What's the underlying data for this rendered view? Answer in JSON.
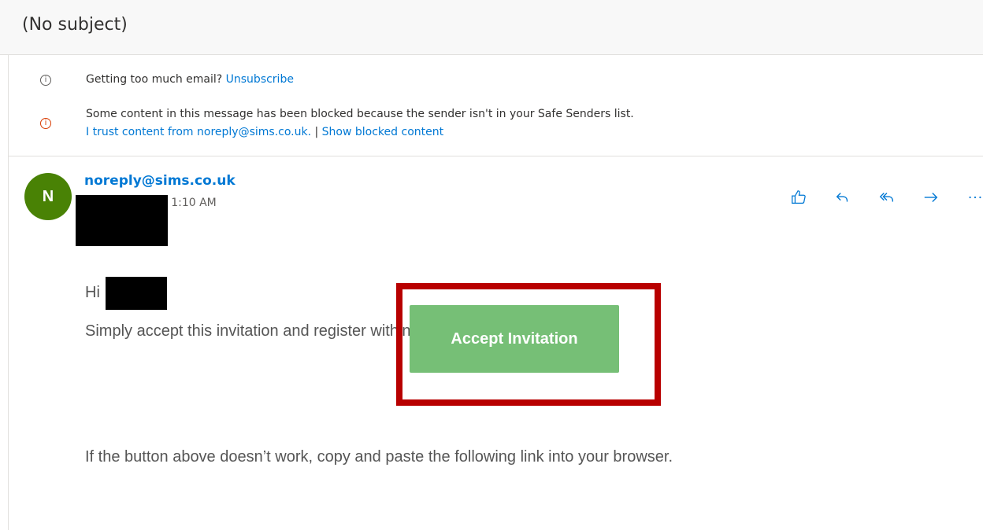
{
  "message": {
    "subject": "(No subject)",
    "sender": "noreply@sims.co.uk",
    "avatar_initial": "N",
    "date": "Mon 3/30/2020 1:10 AM"
  },
  "notices": {
    "unsubscribe_prefix": "Getting too much email?",
    "unsubscribe_link": "Unsubscribe",
    "blocked_message": "Some content in this message has been blocked because the sender isn't in your Safe Senders list.",
    "trust_link": "I trust content from noreply@sims.co.uk.",
    "separator": "|",
    "show_blocked_link": "Show blocked content"
  },
  "actions": [
    {
      "name": "like-icon"
    },
    {
      "name": "reply-icon"
    },
    {
      "name": "reply-all-icon"
    },
    {
      "name": "forward-icon"
    },
    {
      "name": "more-actions-icon"
    }
  ],
  "body": {
    "greeting": "Hi",
    "invitation_text": "Simply accept this invitation and register within 90 days",
    "accept_button": "Accept Invitation",
    "fallback_text": "If the button above doesn’t work, copy and paste the following link into your browser."
  },
  "colors": {
    "link": "#0078d4",
    "avatar": "#498205",
    "accept_button": "#76bf76",
    "highlight": "#b80000"
  }
}
